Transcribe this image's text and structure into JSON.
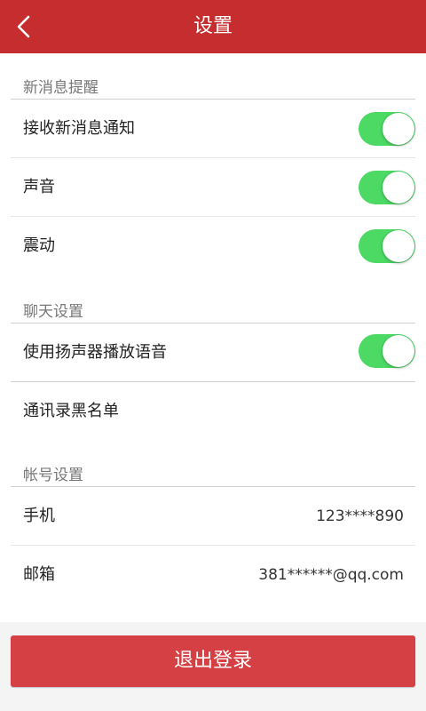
{
  "header": {
    "title": "设置",
    "back_icon": "chevron-left-icon",
    "background": "#c62d2e"
  },
  "sections": {
    "notifications": {
      "header": "新消息提醒",
      "items": [
        {
          "label": "接收新消息通知",
          "toggle": true
        },
        {
          "label": "声音",
          "toggle": true
        },
        {
          "label": "震动",
          "toggle": true
        }
      ]
    },
    "chat": {
      "header": "聊天设置",
      "items": [
        {
          "label": "使用扬声器播放语音",
          "toggle": true
        },
        {
          "label": "通讯录黑名单"
        }
      ]
    },
    "account": {
      "header": "帐号设置",
      "items": [
        {
          "label": "手机",
          "value": "123****890"
        },
        {
          "label": "邮箱",
          "value": "381******@qq.com"
        }
      ]
    }
  },
  "logout": {
    "label": "退出登录",
    "background": "#d44044"
  },
  "colors": {
    "toggle_on": "#4cd964",
    "page_bg": "#f4f4f4"
  }
}
